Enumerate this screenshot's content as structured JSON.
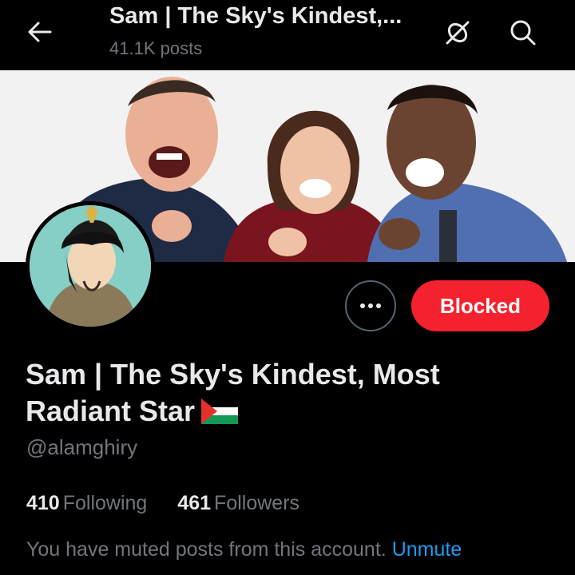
{
  "header": {
    "title": "Sam | The Sky's Kindest,...",
    "subtitle": "41.1K posts",
    "back_icon": "back-arrow-icon",
    "satellite_icon": "satellite-off-icon",
    "search_icon": "search-icon"
  },
  "profile": {
    "display_name": "Sam | The Sky's Kindest, Most Radiant Star",
    "flag_icon": "palestine-flag-icon",
    "handle": "@alamghiry",
    "following_count": "410",
    "following_label": "Following",
    "followers_count": "461",
    "followers_label": "Followers",
    "muted_notice": "You have muted posts from this account.",
    "unmute_label": "Unmute"
  },
  "actions": {
    "more_icon": "more-dots-icon",
    "blocked_label": "Blocked"
  },
  "colors": {
    "background": "#000000",
    "text_primary": "#e7e9ea",
    "text_secondary": "#71767b",
    "blocked_button": "#f4212e",
    "link": "#1d9bf0"
  }
}
